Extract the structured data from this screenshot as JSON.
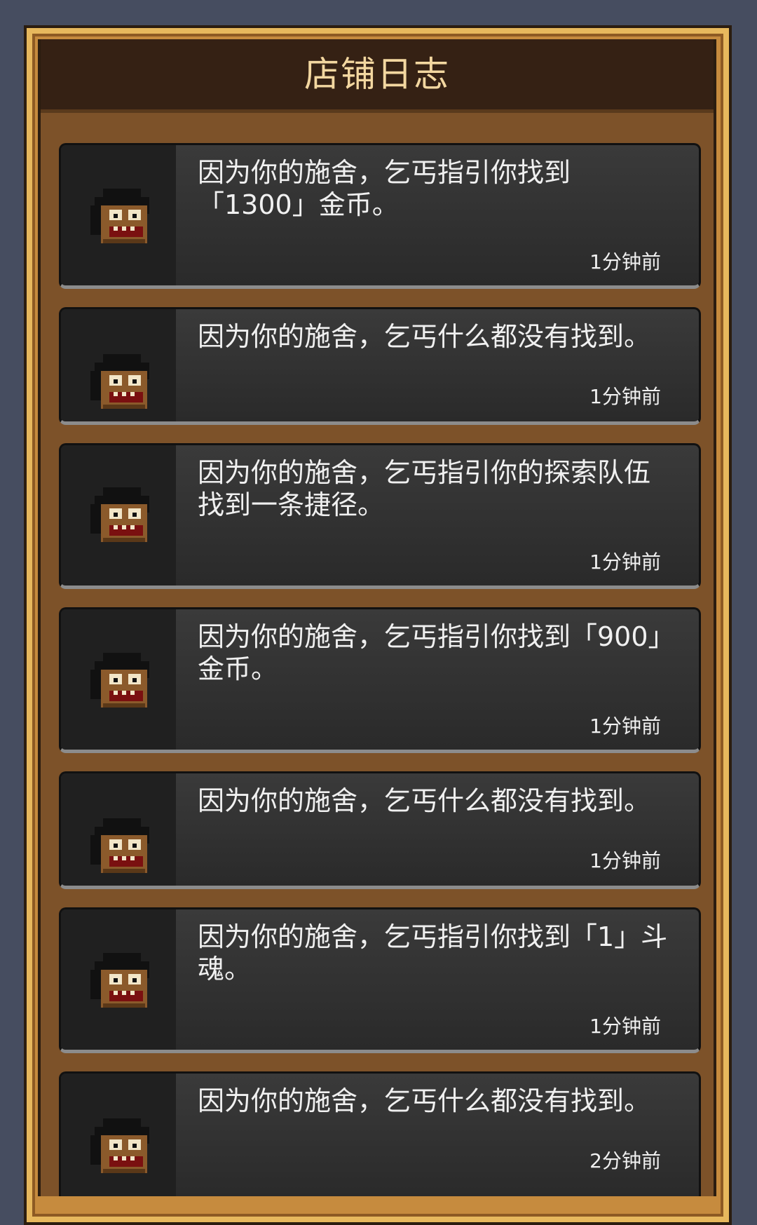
{
  "header": {
    "title": "店铺日志"
  },
  "logs": [
    {
      "text": "因为你的施舍，乞丐指引你找到\n「1300」金币。",
      "time": "1分钟前",
      "icon": "beggar-icon"
    },
    {
      "text": "因为你的施舍，乞丐什么都没有找到。",
      "time": "1分钟前",
      "icon": "beggar-icon"
    },
    {
      "text": "因为你的施舍，乞丐指引你的探索队伍\n找到一条捷径。",
      "time": "1分钟前",
      "icon": "beggar-icon"
    },
    {
      "text": "因为你的施舍，乞丐指引你找到「900」\n金币。",
      "time": "1分钟前",
      "icon": "beggar-icon"
    },
    {
      "text": "因为你的施舍，乞丐什么都没有找到。",
      "time": "1分钟前",
      "icon": "beggar-icon"
    },
    {
      "text": "因为你的施舍，乞丐指引你找到「1」斗\n魂。",
      "time": "1分钟前",
      "icon": "beggar-icon"
    },
    {
      "text": "因为你的施舍，乞丐什么都没有找到。",
      "time": "2分钟前",
      "icon": "beggar-icon"
    }
  ],
  "colors": {
    "background": "#464d60",
    "frame": "#c68b3e",
    "panel": "#7d5229",
    "card": "#2f2f2f",
    "title": "#f3d7a0"
  }
}
